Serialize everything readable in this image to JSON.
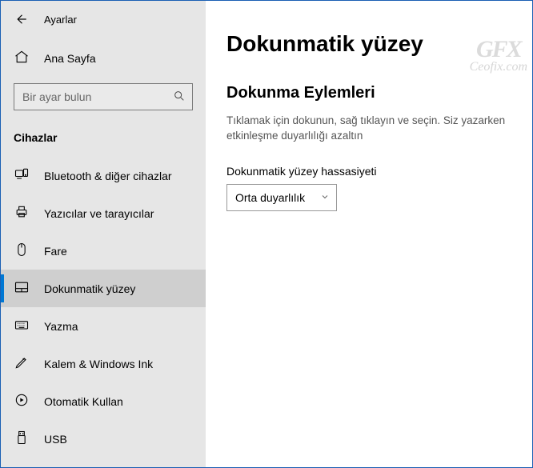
{
  "titlebar": {
    "app_title": "Ayarlar"
  },
  "sidebar": {
    "home_label": "Ana Sayfa",
    "search_placeholder": "Bir ayar bulun",
    "category_label": "Cihazlar",
    "items": [
      {
        "label": "Bluetooth & diğer cihazlar",
        "name": "sidebar-item-bluetooth"
      },
      {
        "label": "Yazıcılar ve tarayıcılar",
        "name": "sidebar-item-printers"
      },
      {
        "label": "Fare",
        "name": "sidebar-item-mouse"
      },
      {
        "label": "Dokunmatik yüzey",
        "name": "sidebar-item-touchpad",
        "active": true
      },
      {
        "label": "Yazma",
        "name": "sidebar-item-typing"
      },
      {
        "label": "Kalem & Windows Ink",
        "name": "sidebar-item-pen"
      },
      {
        "label": "Otomatik Kullan",
        "name": "sidebar-item-autoplay"
      },
      {
        "label": "USB",
        "name": "sidebar-item-usb"
      }
    ]
  },
  "main": {
    "page_title": "Dokunmatik yüzey",
    "section_title": "Dokunma Eylemleri",
    "section_desc": "Tıklamak için dokunun, sağ tıklayın ve seçin. Siz yazarken etkinleşme duyarlılığı azaltın",
    "sensitivity_label": "Dokunmatik yüzey hassasiyeti",
    "sensitivity_value": "Orta duyarlılık"
  },
  "watermark": {
    "big": "GFX",
    "small": "Ceofix.com"
  }
}
